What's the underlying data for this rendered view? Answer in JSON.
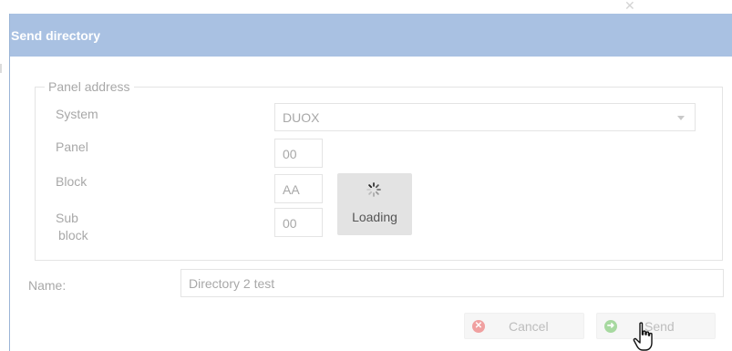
{
  "dialog": {
    "title": "Send directory",
    "panel_address": {
      "legend": "Panel address",
      "system_label": "System",
      "system_value": "DUOX",
      "panel_label": "Panel",
      "panel_value": "00",
      "block_label": "Block",
      "block_value": "AA",
      "subblock_label_line1": "Sub",
      "subblock_label_line2": "block",
      "subblock_value": "00"
    },
    "loading_text": "Loading",
    "name_label": "Name:",
    "name_value": "Directory 2 test",
    "cancel_label": "Cancel",
    "send_label": "Send"
  },
  "colors": {
    "titlebar": "#a9c1e2",
    "cancel_icon": "#f0a0a0",
    "send_icon": "#a7d9a0"
  },
  "icons": [
    "close-icon",
    "chevron-down-icon",
    "spinner-icon",
    "cancel-icon",
    "send-icon",
    "hand-cursor-icon"
  ]
}
